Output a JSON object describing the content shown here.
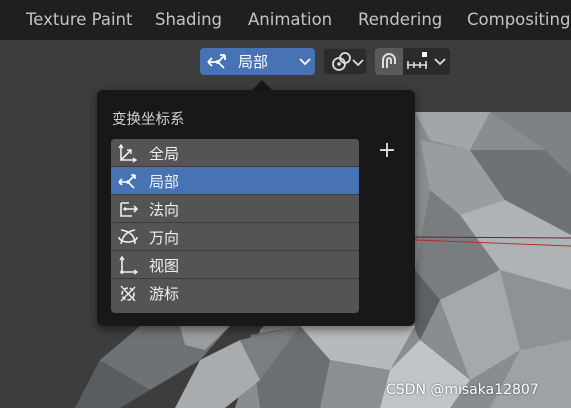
{
  "workspace_tabs": [
    "Texture Paint",
    "Shading",
    "Animation",
    "Rendering",
    "Compositing"
  ],
  "header": {
    "orientation_value": "局部",
    "orientation_icon": "local-axes-icon",
    "pivot_icon": "pivot-icon",
    "snap_icon": "snap-magnet-icon",
    "snap_target_icon": "snap-increment-icon"
  },
  "orientation_menu": {
    "title": "变换坐标系",
    "add_label": "+",
    "items": [
      {
        "label": "全局",
        "icon": "global-axes-icon",
        "active": false
      },
      {
        "label": "局部",
        "icon": "local-axes-icon",
        "active": true
      },
      {
        "label": "法向",
        "icon": "normal-axes-icon",
        "active": false
      },
      {
        "label": "万向",
        "icon": "gimbal-icon",
        "active": false
      },
      {
        "label": "视图",
        "icon": "view-axes-icon",
        "active": false
      },
      {
        "label": "游标",
        "icon": "cursor-axes-icon",
        "active": false
      }
    ]
  },
  "colors": {
    "accent": "#4772b3",
    "menu_bg": "#181818",
    "item_bg": "#545454",
    "topbar_bg": "#1f1f1f"
  },
  "watermark": "CSDN @misaka12807"
}
